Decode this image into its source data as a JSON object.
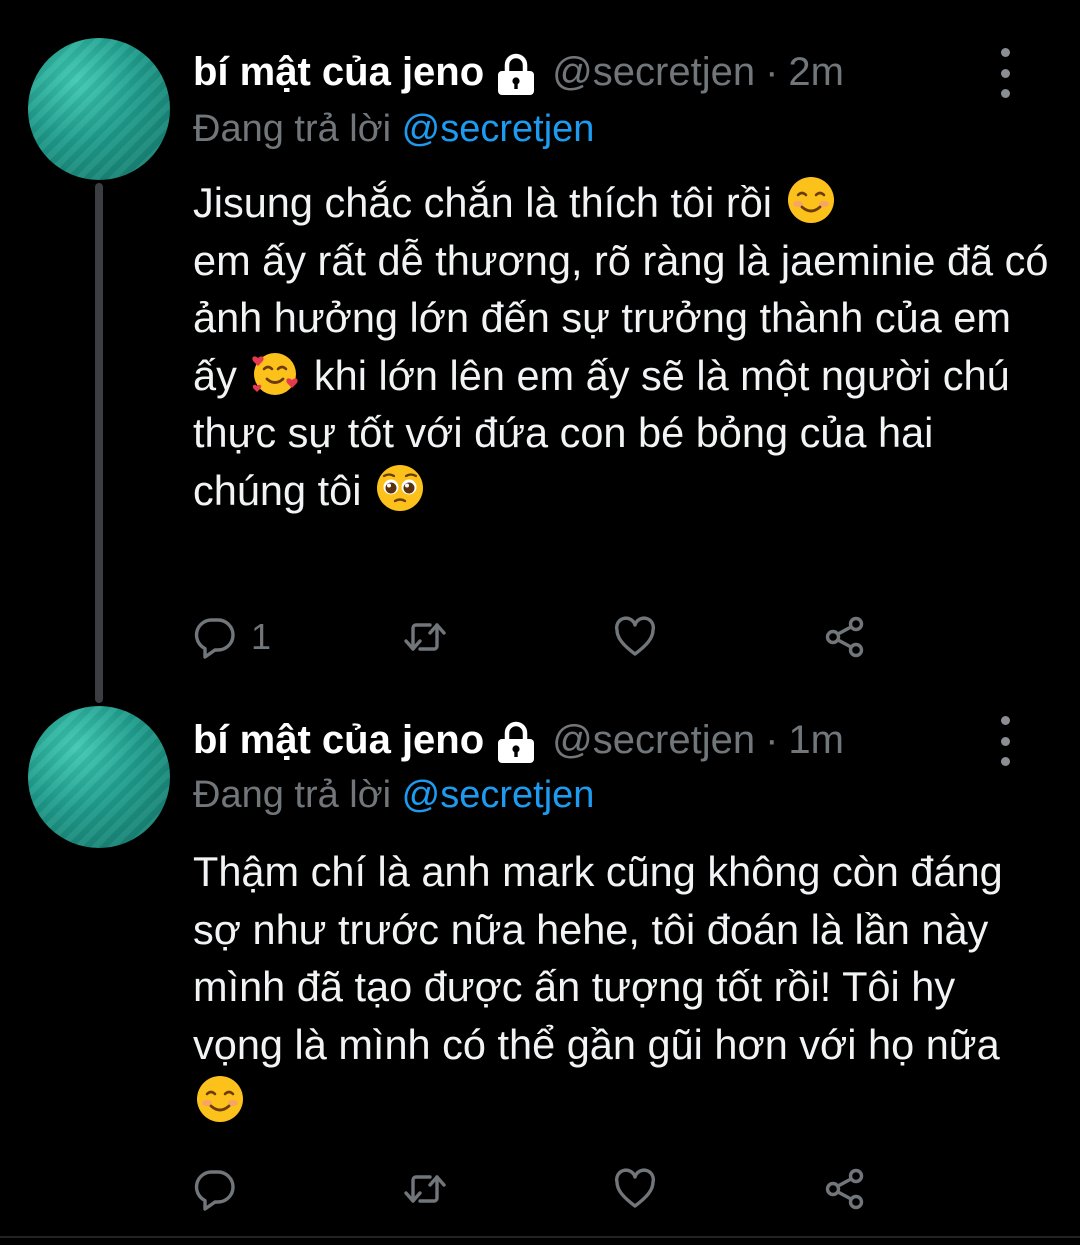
{
  "tweets": [
    {
      "display_name": "bí mật của jeno",
      "handle": "@secretjen",
      "separator": "·",
      "time": "2m",
      "replying_prefix": "Đang trả lời",
      "replying_to": "@secretjen",
      "text_parts": {
        "p1": "Jisung chắc chắn là thích tôi rồi",
        "p2": "em ấy rất dễ thương, rõ ràng là jaeminie đã có ảnh hưởng lớn đến sự trưởng thành của em ấy",
        "p3": "khi lớn lên em ấy sẽ là một người chú thực sự tốt với đứa con bé bỏng của hai chúng tôi"
      },
      "emojis": [
        "smiling-face-emoji",
        "smiling-face-with-hearts-emoji",
        "pleading-face-emoji"
      ],
      "reply_count": "1"
    },
    {
      "display_name": "bí mật của jeno",
      "handle": "@secretjen",
      "separator": "·",
      "time": "1m",
      "replying_prefix": "Đang trả lời",
      "replying_to": "@secretjen",
      "text_parts": {
        "p1": "Thậm chí là anh mark cũng không còn đáng sợ như trước nữa hehe, tôi đoán là lần này mình đã tạo được ấn tượng tốt rồi! Tôi hy vọng là mình có thể gần gũi hơn với họ nữa"
      },
      "emojis": [
        "smiling-face-emoji"
      ],
      "reply_count": ""
    }
  ],
  "colors": {
    "background": "#000000",
    "text": "#e7e9ea",
    "muted": "#71767b",
    "mention": "#1d9bf0",
    "avatar": "#1f9c8c"
  },
  "icons": [
    "reply-icon",
    "retweet-icon",
    "like-icon",
    "share-icon",
    "lock-icon",
    "more-icon"
  ]
}
